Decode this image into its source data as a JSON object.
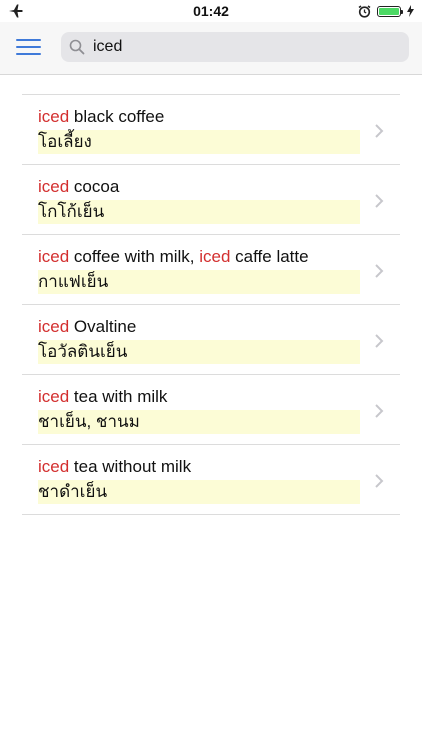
{
  "status_bar": {
    "time": "01:42",
    "icons": [
      "airplane-icon",
      "alarm-icon",
      "battery-icon",
      "charging-icon"
    ],
    "battery_level": 1.0,
    "battery_color": "#4cd964"
  },
  "search": {
    "value": "iced",
    "accent_color": "#3f7ad9"
  },
  "results": [
    {
      "parts": [
        {
          "t": "iced",
          "h": true
        },
        {
          "t": " black coffee",
          "h": false
        }
      ],
      "thai": "โอเลี้ยง"
    },
    {
      "parts": [
        {
          "t": "iced",
          "h": true
        },
        {
          "t": " cocoa",
          "h": false
        }
      ],
      "thai": "โกโก้เย็น"
    },
    {
      "parts": [
        {
          "t": "iced",
          "h": true
        },
        {
          "t": " coffee with milk, ",
          "h": false
        },
        {
          "t": "iced",
          "h": true
        },
        {
          "t": " caffe latte",
          "h": false
        }
      ],
      "thai": "กาแฟเย็น"
    },
    {
      "parts": [
        {
          "t": "iced",
          "h": true
        },
        {
          "t": " Ovaltine",
          "h": false
        }
      ],
      "thai": "โอวัลตินเย็น"
    },
    {
      "parts": [
        {
          "t": "iced",
          "h": true
        },
        {
          "t": " tea with milk",
          "h": false
        }
      ],
      "thai": "ชาเย็น, ชานม"
    },
    {
      "parts": [
        {
          "t": "iced",
          "h": true
        },
        {
          "t": " tea without milk",
          "h": false
        }
      ],
      "thai": "ชาดำเย็น"
    }
  ],
  "colors": {
    "highlight_text": "#d32f2f",
    "translation_background": "#fcfcd6"
  }
}
